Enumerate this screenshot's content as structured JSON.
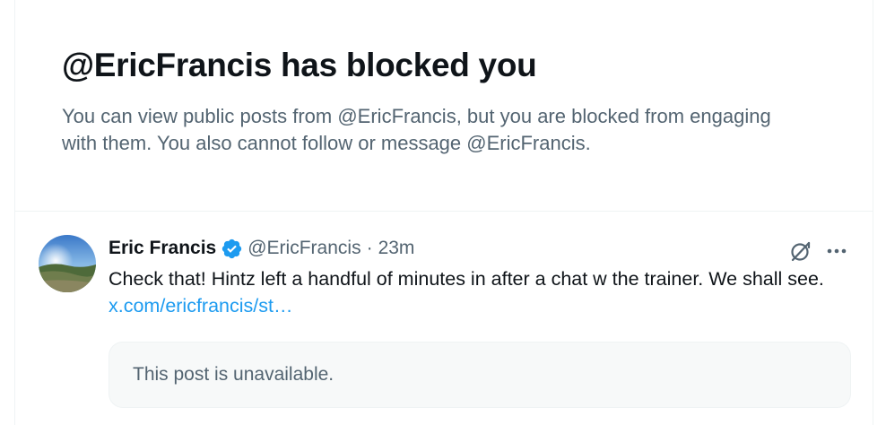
{
  "blocked": {
    "title": "@EricFrancis has blocked you",
    "description": "You can view public posts from @EricFrancis, but you are blocked from engaging with them. You also cannot follow or message @EricFrancis."
  },
  "tweet": {
    "author_name": "Eric Francis",
    "author_handle": "@EricFrancis",
    "separator": "·",
    "timestamp": "23m",
    "text": "Check that! Hintz left a handful of minutes in after a chat w the trainer. We shall see. ",
    "link_text": "x.com/ericfrancis/st…",
    "quoted_unavailable": "This post is unavailable.",
    "icons": {
      "verified": "verified-badge-icon",
      "grok": "grok-icon",
      "more": "more-options-icon"
    }
  },
  "colors": {
    "text_primary": "#0f1419",
    "text_secondary": "#536471",
    "link": "#1d9bf0",
    "border": "#eff3f4",
    "box_bg": "#f7f9f9"
  }
}
